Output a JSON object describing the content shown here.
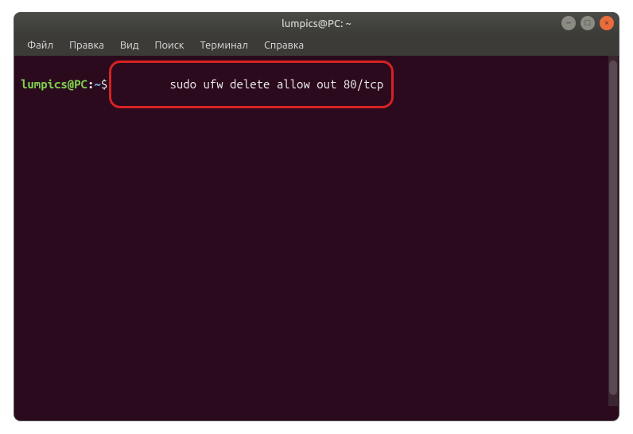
{
  "window": {
    "title": "lumpics@PC: ~"
  },
  "menubar": {
    "items": [
      "Файл",
      "Правка",
      "Вид",
      "Поиск",
      "Терминал",
      "Справка"
    ]
  },
  "terminal": {
    "prompt": {
      "user_host": "lumpics@PC",
      "colon": ":",
      "path": "~",
      "symbol": "$"
    },
    "command": "sudo ufw delete allow out 80/tcp"
  },
  "win_controls": {
    "min_glyph": "–",
    "max_glyph": "□",
    "close_glyph": "×"
  }
}
